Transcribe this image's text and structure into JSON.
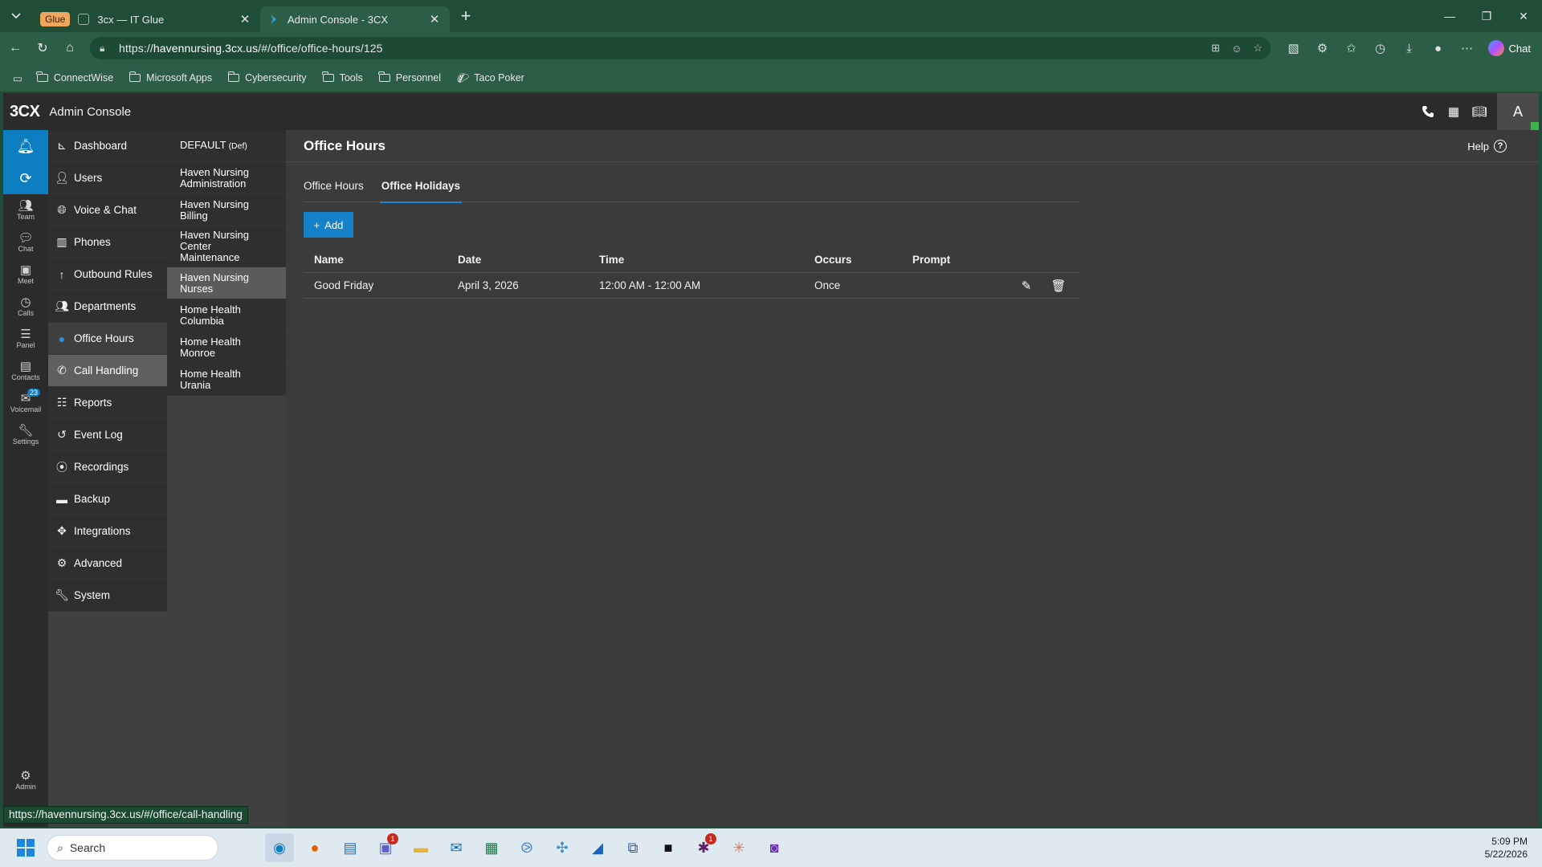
{
  "browser": {
    "tabs": [
      {
        "group_label": "Glue",
        "title": "3cx — IT Glue",
        "active": false
      },
      {
        "title": "Admin Console - 3CX",
        "active": true
      }
    ],
    "url_prefix": "https://",
    "url_host": "havennursing.3cx.us",
    "url_path": "/#/office/office-hours/125",
    "copilot_label": "Chat",
    "bookmarks": [
      "ConnectWise",
      "Microsoft Apps",
      "Cybersecurity",
      "Tools",
      "Personnel",
      "Taco Poker"
    ],
    "status_url": "https://havennursing.3cx.us/#/office/call-handling"
  },
  "app": {
    "logo": "3CX",
    "title": "Admin Console",
    "avatar_initial": "A",
    "rail": [
      {
        "label": "Team",
        "icon": "team-icon"
      },
      {
        "label": "Chat",
        "icon": "chat-icon"
      },
      {
        "label": "Meet",
        "icon": "meet-icon"
      },
      {
        "label": "Calls",
        "icon": "calls-icon"
      },
      {
        "label": "Panel",
        "icon": "panel-icon"
      },
      {
        "label": "Contacts",
        "icon": "contacts-icon"
      },
      {
        "label": "Voicemail",
        "icon": "voicemail-icon"
      },
      {
        "label": "Settings",
        "icon": "settings-icon"
      }
    ],
    "voicemail_badge": "23",
    "admin_label": "Admin",
    "nav": [
      {
        "label": "Dashboard",
        "icon": "dashboard-icon"
      },
      {
        "label": "Users",
        "icon": "user-icon"
      },
      {
        "label": "Voice & Chat",
        "icon": "globe-icon"
      },
      {
        "label": "Phones",
        "icon": "phones-icon"
      },
      {
        "label": "Outbound Rules",
        "icon": "arrow-up-icon"
      },
      {
        "label": "Departments",
        "icon": "departments-icon"
      },
      {
        "label": "Office Hours",
        "icon": "clock-icon"
      },
      {
        "label": "Call Handling",
        "icon": "phone-icon"
      },
      {
        "label": "Reports",
        "icon": "reports-icon"
      },
      {
        "label": "Event Log",
        "icon": "history-icon"
      },
      {
        "label": "Recordings",
        "icon": "record-icon"
      },
      {
        "label": "Backup",
        "icon": "archive-icon"
      },
      {
        "label": "Integrations",
        "icon": "puzzle-icon"
      },
      {
        "label": "Advanced",
        "icon": "gear-icon"
      },
      {
        "label": "System",
        "icon": "wrench-icon"
      }
    ],
    "departments": [
      {
        "line1": "DEFAULT",
        "def": "(Def)"
      },
      {
        "line1": "Haven Nursing",
        "line2": "Administration"
      },
      {
        "line1": "Haven Nursing",
        "line2": "Billing"
      },
      {
        "line1": "Haven Nursing",
        "line2": "Center Maintenance"
      },
      {
        "line1": "Haven Nursing",
        "line2": "Nurses"
      },
      {
        "line1": "Home Health",
        "line2": "Columbia"
      },
      {
        "line1": "Home Health",
        "line2": "Monroe"
      },
      {
        "line1": "Home Health Urania"
      }
    ]
  },
  "content": {
    "page_title": "Office Hours",
    "help_label": "Help",
    "tabs": [
      "Office Hours",
      "Office Holidays"
    ],
    "add_label": "Add",
    "columns": [
      "Name",
      "Date",
      "Time",
      "Occurs",
      "Prompt"
    ],
    "rows": [
      {
        "name": "Good Friday",
        "date": "April 3, 2026",
        "time": "12:00 AM - 12:00 AM",
        "occurs": "Once",
        "prompt": ""
      }
    ]
  },
  "taskbar": {
    "search_placeholder": "Search",
    "time": "5:09 PM",
    "date": "5/22/2026",
    "teams_badge": "1",
    "slack_badge": "1"
  },
  "colors": {
    "browser_frame": "#1f4d35",
    "accent_blue": "#1581c9",
    "app_bg": "#3b3b3b"
  }
}
